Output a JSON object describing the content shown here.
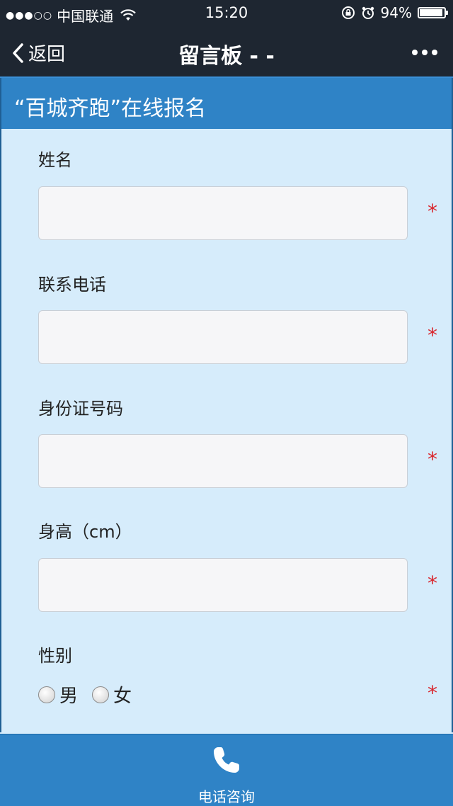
{
  "status_bar": {
    "signal": "●●●○○",
    "carrier": "中国联通",
    "time": "15:20",
    "battery_percent_label": "94%",
    "battery_level": 0.94
  },
  "nav": {
    "back_label": "返回",
    "title": "留言板 - -"
  },
  "form": {
    "title": "“百城齐跑”在线报名",
    "required_symbol": "*",
    "fields": [
      {
        "label": "姓名",
        "value": ""
      },
      {
        "label": "联系电话",
        "value": ""
      },
      {
        "label": "身份证号码",
        "value": ""
      },
      {
        "label": "身高（cm）",
        "value": ""
      }
    ],
    "gender": {
      "label": "性别",
      "options": [
        "男",
        "女"
      ]
    }
  },
  "bottom_bar": {
    "label": "电话咨询",
    "icon": "phone-icon"
  },
  "colors": {
    "nav_bg": "#1e2631",
    "header_bg": "#2f83c6",
    "form_bg": "#d6ecfb",
    "required": "#d9262d"
  }
}
